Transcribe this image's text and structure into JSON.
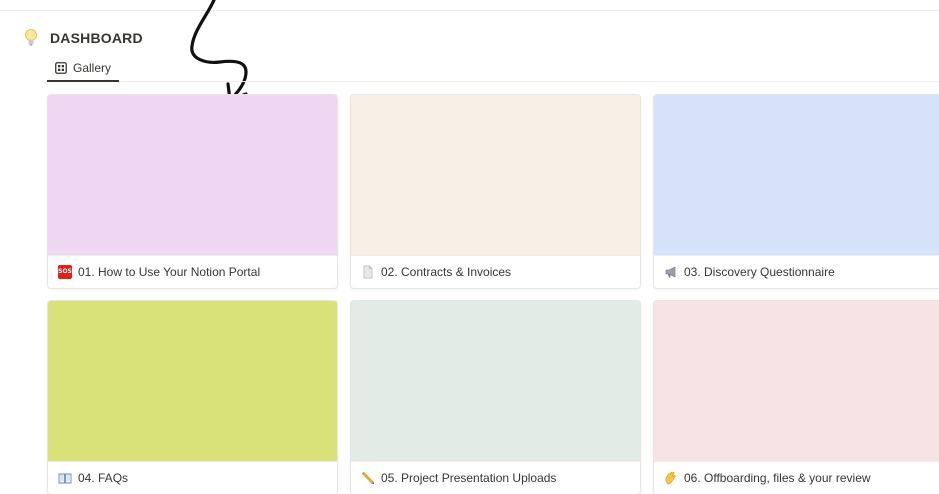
{
  "header": {
    "title": "DASHBOARD",
    "icon": "lightbulb-icon"
  },
  "tabs": [
    {
      "label": "Gallery",
      "icon": "gallery-grid-icon"
    }
  ],
  "cards": [
    {
      "title": "01. How to Use Your Notion Portal",
      "icon": "sos-icon",
      "icon_text": "SOS",
      "cover_color": "#efd6f3"
    },
    {
      "title": "02. Contracts & Invoices",
      "icon": "page-icon",
      "cover_color": "#f8f0e7"
    },
    {
      "title": "03. Discovery Questionnaire",
      "icon": "megaphone-icon",
      "cover_color": "#d5e2fa"
    },
    {
      "title": "04. FAQs",
      "icon": "open-book-icon",
      "cover_color": "#d9e179"
    },
    {
      "title": "05. Project Presentation Uploads",
      "icon": "pencil-icon",
      "cover_color": "#e2ebe6"
    },
    {
      "title": "06. Offboarding, files & your review",
      "icon": "waving-hand-icon",
      "cover_color": "#f7e3e3"
    }
  ]
}
